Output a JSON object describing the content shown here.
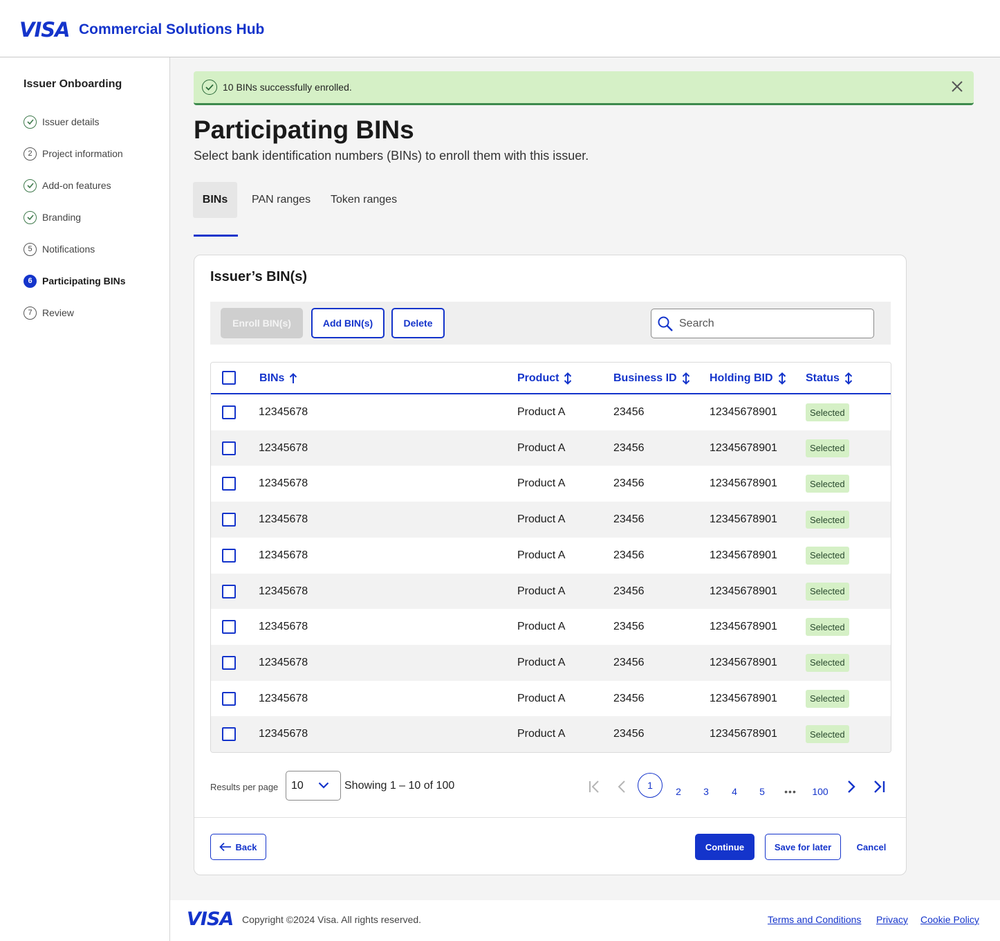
{
  "header": {
    "logo": "VISA",
    "title": "Commercial Solutions Hub"
  },
  "sidebar": {
    "title": "Issuer Onboarding",
    "items": [
      {
        "label": "Issuer details",
        "marker": "",
        "state": "complete"
      },
      {
        "label": "Project information",
        "marker": "2",
        "state": "pending"
      },
      {
        "label": "Add-on features",
        "marker": "",
        "state": "complete"
      },
      {
        "label": "Branding",
        "marker": "",
        "state": "complete"
      },
      {
        "label": "Notifications",
        "marker": "5",
        "state": "pending"
      },
      {
        "label": "Participating BINs",
        "marker": "6",
        "state": "active"
      },
      {
        "label": "Review",
        "marker": "7",
        "state": "pending"
      }
    ]
  },
  "alert": {
    "text": "10 BINs successfully enrolled."
  },
  "page": {
    "title": "Participating BINs",
    "subtitle": "Select bank identification numbers (BINs) to enroll them with this issuer."
  },
  "tabs": [
    {
      "label": "BINs",
      "active": true
    },
    {
      "label": "PAN ranges",
      "active": false
    },
    {
      "label": "Token ranges",
      "active": false
    }
  ],
  "card": {
    "title": "Issuer’s BIN(s)"
  },
  "toolbar": {
    "enroll_label": "Enroll BIN(s)",
    "add_label": "Add BIN(s)",
    "delete_label": "Delete",
    "search_placeholder": "Search"
  },
  "table": {
    "columns": [
      "BINs",
      "Product",
      "Business ID",
      "Holding BID",
      "Status"
    ],
    "rows": [
      {
        "bin": "12345678",
        "product": "Product A",
        "business_id": "23456",
        "holding_bid": "12345678901",
        "status": "Selected"
      },
      {
        "bin": "12345678",
        "product": "Product A",
        "business_id": "23456",
        "holding_bid": "12345678901",
        "status": "Selected"
      },
      {
        "bin": "12345678",
        "product": "Product A",
        "business_id": "23456",
        "holding_bid": "12345678901",
        "status": "Selected"
      },
      {
        "bin": "12345678",
        "product": "Product A",
        "business_id": "23456",
        "holding_bid": "12345678901",
        "status": "Selected"
      },
      {
        "bin": "12345678",
        "product": "Product A",
        "business_id": "23456",
        "holding_bid": "12345678901",
        "status": "Selected"
      },
      {
        "bin": "12345678",
        "product": "Product A",
        "business_id": "23456",
        "holding_bid": "12345678901",
        "status": "Selected"
      },
      {
        "bin": "12345678",
        "product": "Product A",
        "business_id": "23456",
        "holding_bid": "12345678901",
        "status": "Selected"
      },
      {
        "bin": "12345678",
        "product": "Product A",
        "business_id": "23456",
        "holding_bid": "12345678901",
        "status": "Selected"
      },
      {
        "bin": "12345678",
        "product": "Product A",
        "business_id": "23456",
        "holding_bid": "12345678901",
        "status": "Selected"
      },
      {
        "bin": "12345678",
        "product": "Product A",
        "business_id": "23456",
        "holding_bid": "12345678901",
        "status": "Selected"
      }
    ]
  },
  "pagination": {
    "results_label": "Results per page",
    "per_page": "10",
    "showing": "Showing 1 – 10 of 100",
    "pages": [
      "1",
      "2",
      "3",
      "4",
      "5",
      "•••",
      "100"
    ],
    "current_page": "1"
  },
  "actions": {
    "back_label": "Back",
    "continue_label": "Continue",
    "save_label": "Save for later",
    "cancel_label": "Cancel"
  },
  "footer": {
    "logo": "VISA",
    "copyright": "Copyright ©2024 Visa. All rights reserved.",
    "links": [
      "Terms and Conditions",
      "Privacy",
      "Cookie Policy"
    ]
  },
  "colors": {
    "brand": "#1434cb",
    "success_bg": "#d5f0c6",
    "success_border": "#3d8a4d"
  }
}
